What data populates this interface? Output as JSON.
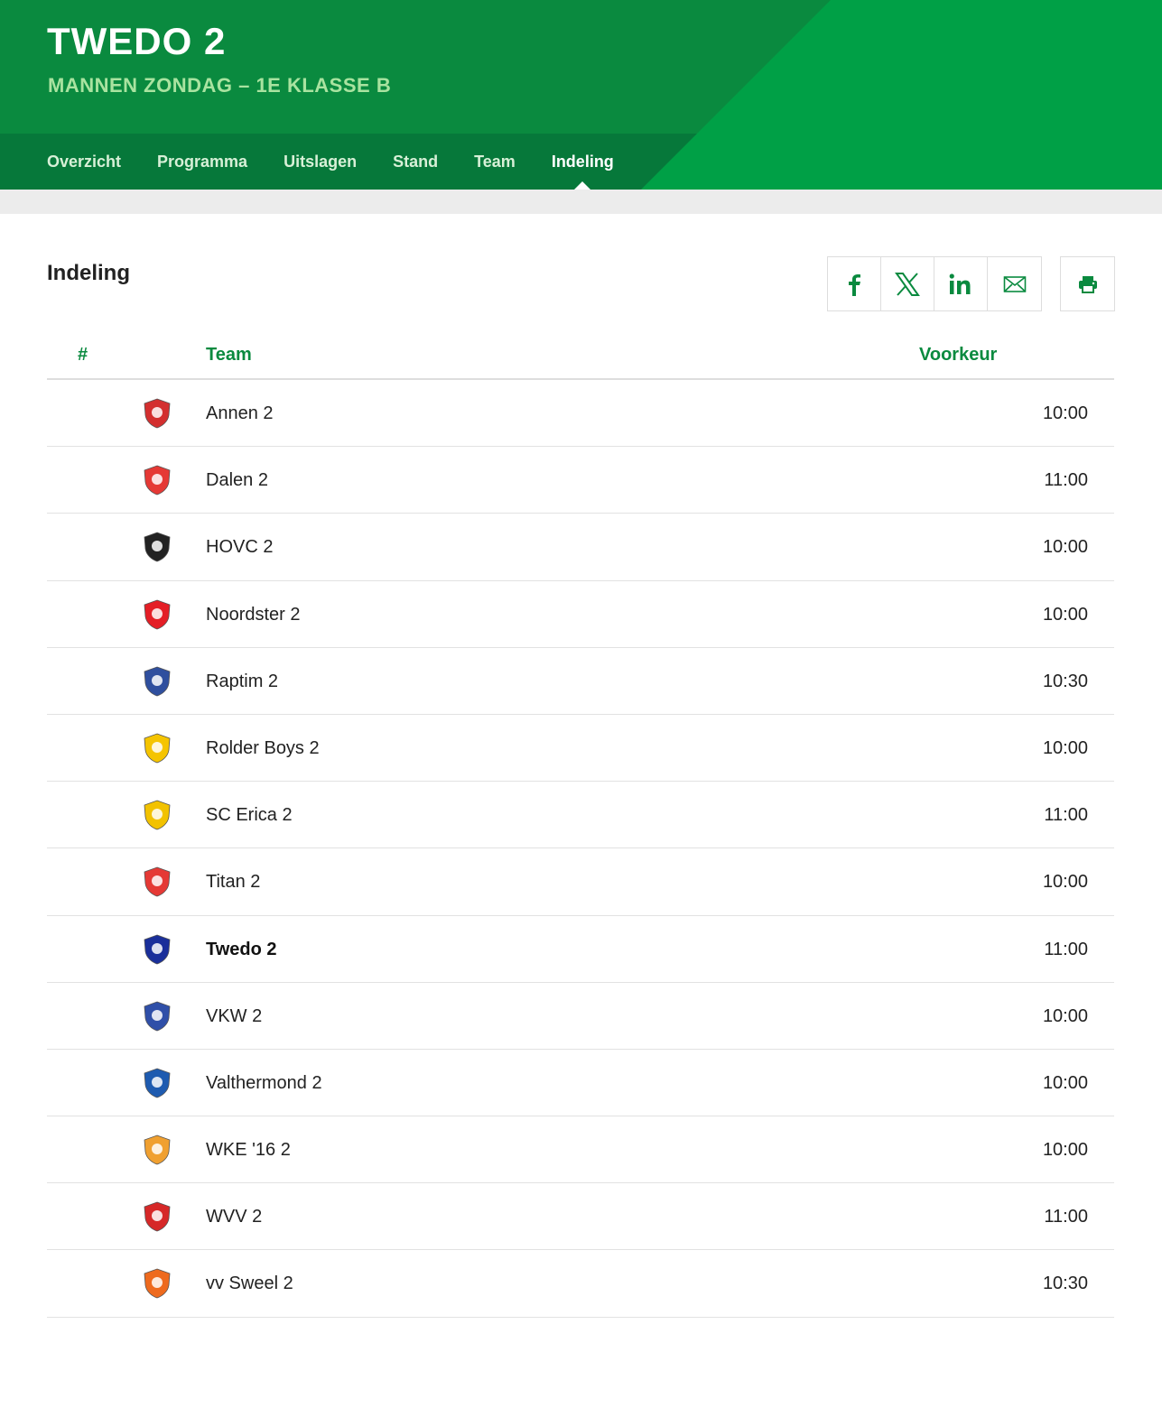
{
  "header": {
    "title": "TWEDO 2",
    "subtitle": "MANNEN ZONDAG – 1E KLASSE B"
  },
  "nav": {
    "items": [
      "Overzicht",
      "Programma",
      "Uitslagen",
      "Stand",
      "Team",
      "Indeling"
    ],
    "active": "Indeling"
  },
  "section": {
    "title": "Indeling"
  },
  "share": {
    "buttons": [
      "facebook-icon",
      "x-icon",
      "linkedin-icon",
      "mail-icon"
    ],
    "print": "printer-icon"
  },
  "table": {
    "headers": {
      "num": "#",
      "team": "Team",
      "pref": "Voorkeur"
    },
    "rows": [
      {
        "team": "Annen 2",
        "time": "10:00",
        "logo": "annen-logo",
        "color": "#d32f2f",
        "bold": false
      },
      {
        "team": "Dalen 2",
        "time": "11:00",
        "logo": "dalen-logo",
        "color": "#e53935",
        "bold": false
      },
      {
        "team": "HOVC 2",
        "time": "10:00",
        "logo": "hovc-logo",
        "color": "#222222",
        "bold": false
      },
      {
        "team": "Noordster 2",
        "time": "10:00",
        "logo": "noordster-logo",
        "color": "#e41e26",
        "bold": false
      },
      {
        "team": "Raptim 2",
        "time": "10:30",
        "logo": "raptim-logo",
        "color": "#2f4f9e",
        "bold": false
      },
      {
        "team": "Rolder Boys 2",
        "time": "10:00",
        "logo": "rolder-boys-logo",
        "color": "#f5c400",
        "bold": false
      },
      {
        "team": "SC Erica 2",
        "time": "11:00",
        "logo": "sc-erica-logo",
        "color": "#f2c200",
        "bold": false
      },
      {
        "team": "Titan 2",
        "time": "10:00",
        "logo": "titan-logo",
        "color": "#e53935",
        "bold": false
      },
      {
        "team": "Twedo 2",
        "time": "11:00",
        "logo": "twedo-logo",
        "color": "#1a2f9a",
        "bold": true
      },
      {
        "team": "VKW 2",
        "time": "10:00",
        "logo": "vkw-logo",
        "color": "#2f4fa8",
        "bold": false
      },
      {
        "team": "Valthermond 2",
        "time": "10:00",
        "logo": "valthermond-logo",
        "color": "#1e5bb0",
        "bold": false
      },
      {
        "team": "WKE '16 2",
        "time": "10:00",
        "logo": "wke16-logo",
        "color": "#f0a030",
        "bold": false
      },
      {
        "team": "WVV 2",
        "time": "11:00",
        "logo": "wvv-logo",
        "color": "#d62828",
        "bold": false
      },
      {
        "team": "vv Sweel 2",
        "time": "10:30",
        "logo": "vv-sweel-logo",
        "color": "#ee6a1e",
        "bold": false
      }
    ]
  },
  "colors": {
    "brand": "#0a8a3f",
    "brand_dark": "#06783a",
    "brand_light": "#00a046"
  }
}
